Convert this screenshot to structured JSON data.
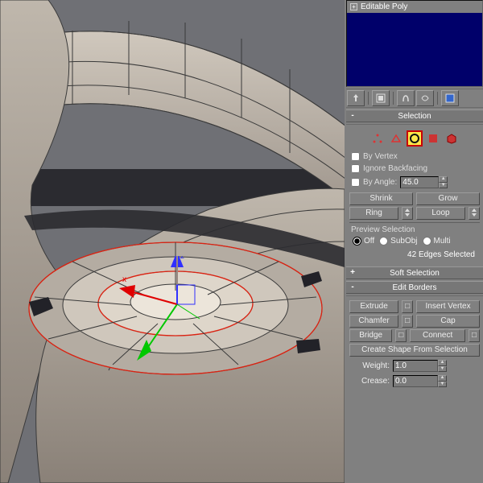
{
  "modifier_stack": {
    "item": "Editable Poly",
    "expand": "+"
  },
  "stack_icons": [
    "pin",
    "sep",
    "show",
    "sep",
    "u1",
    "u2",
    "sep",
    "cfg"
  ],
  "selection": {
    "title": "Selection",
    "toggle": "-",
    "by_vertex": "By Vertex",
    "ignore_backfacing": "Ignore Backfacing",
    "by_angle": "By Angle:",
    "angle_value": "45.0",
    "shrink": "Shrink",
    "grow": "Grow",
    "ring": "Ring",
    "loop": "Loop",
    "preview_group": "Preview Selection",
    "opt_off": "Off",
    "opt_subobj": "SubObj",
    "opt_multi": "Multi",
    "status": "42 Edges Selected"
  },
  "soft": {
    "title": "Soft Selection",
    "toggle": "+"
  },
  "borders": {
    "title": "Edit Borders",
    "toggle": "-",
    "extrude": "Extrude",
    "insert_vertex": "Insert Vertex",
    "chamfer": "Chamfer",
    "cap": "Cap",
    "bridge": "Bridge",
    "connect": "Connect",
    "create_shape": "Create Shape From Selection",
    "weight": "Weight:",
    "weight_val": "1.0",
    "crease": "Crease:",
    "crease_val": "0.0"
  }
}
